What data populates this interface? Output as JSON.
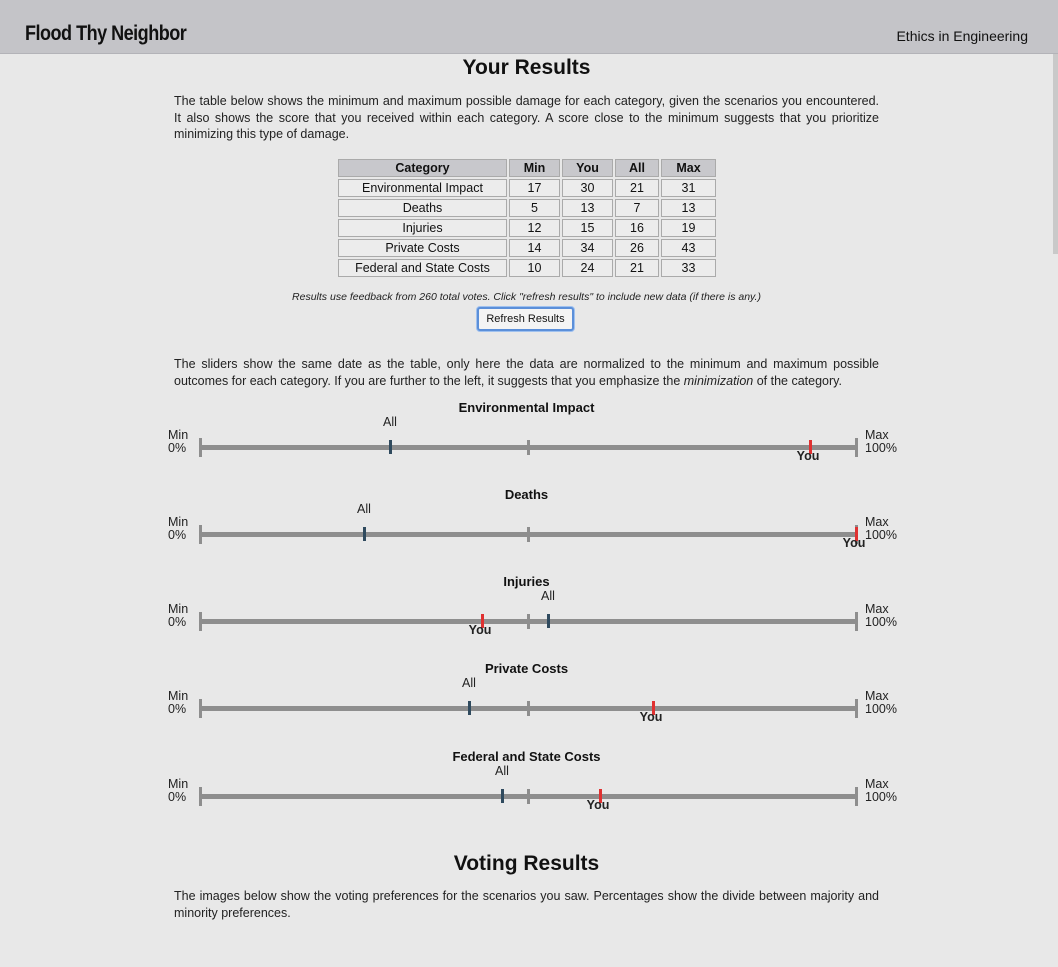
{
  "header": {
    "brand": "Flood Thy Neighbor",
    "nav_link": "Ethics in Engineering"
  },
  "results": {
    "title": "Your Results",
    "intro": "The table below shows the minimum and maximum possible damage for each category, given the scenarios you encountered. It also shows the score that you received within each category. A score close to the minimum suggests that you prioritize minimizing this type of damage.",
    "columns": [
      "Category",
      "Min",
      "You",
      "All",
      "Max"
    ],
    "rows": [
      [
        "Environmental Impact",
        "17",
        "30",
        "21",
        "31"
      ],
      [
        "Deaths",
        "5",
        "13",
        "7",
        "13"
      ],
      [
        "Injuries",
        "12",
        "15",
        "16",
        "19"
      ],
      [
        "Private Costs",
        "14",
        "34",
        "26",
        "43"
      ],
      [
        "Federal and State Costs",
        "10",
        "24",
        "21",
        "33"
      ]
    ],
    "note": "Results use feedback from 260 total votes. Click \"refresh results\" to include new data (if there is any.)",
    "refresh_button": "Refresh Results"
  },
  "sliders": {
    "intro_before": "The sliders show the same date as the table, only here the data are normalized to the minimum and maximum possible outcomes for each category. If you are further to the left, it suggests that you emphasize the ",
    "intro_em": "minimization",
    "intro_after": " of the category.",
    "min_label": "Min",
    "min_pct": "0%",
    "max_label": "Max",
    "max_pct": "100%",
    "all_label": "All",
    "you_label": "You",
    "you_color": "#e03131",
    "all_color": "#2f4a5e",
    "items": [
      {
        "title": "Environmental Impact",
        "all": 0.29,
        "you": 0.93
      },
      {
        "title": "Deaths",
        "all": 0.25,
        "you": 1.0
      },
      {
        "title": "Injuries",
        "all": 0.53,
        "you": 0.43
      },
      {
        "title": "Private Costs",
        "all": 0.41,
        "you": 0.69
      },
      {
        "title": "Federal and State Costs",
        "all": 0.46,
        "you": 0.61
      }
    ]
  },
  "voting": {
    "title": "Voting Results",
    "intro": "The images below show the voting preferences for the scenarios you saw. Percentages show the divide between majority and minority preferences."
  }
}
